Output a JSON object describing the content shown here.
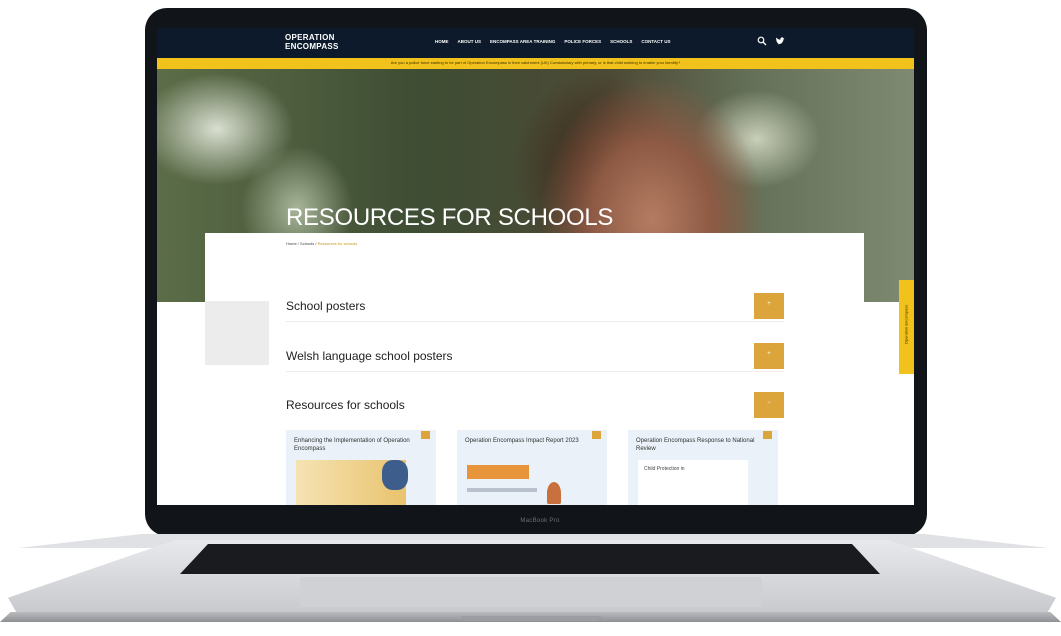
{
  "device": {
    "model_label": "MacBook Pro"
  },
  "site": {
    "logo_line1": "OPERATION",
    "logo_line2": "ENCOMPASS",
    "nav": [
      "HOME",
      "ABOUT US",
      "ENCOMPASS AREA TRAINING",
      "POLICE FORCES",
      "SCHOOLS",
      "CONTACT US"
    ],
    "icons": [
      "search-icon",
      "twitter-icon"
    ],
    "banner_text": "Are you a police force starting to be part of Operation Encompass in their catchment (UK) Constabulary with primary, or is that child working to enable your identity?",
    "hero_title": "RESOURCES FOR SCHOOLS",
    "breadcrumb": {
      "home": "Home",
      "sep": "/",
      "section": "Schools",
      "current": "Resources for schools"
    },
    "accordion": [
      {
        "title": "School posters",
        "button": "+"
      },
      {
        "title": "Welsh language school posters",
        "button": "+"
      },
      {
        "title": "Resources for schools",
        "button": "−"
      }
    ],
    "cards": [
      {
        "title": "Enhancing the Implementation of Operation Encompass"
      },
      {
        "title": "Operation Encompass Impact Report 2023"
      },
      {
        "title": "Operation Encompass Response to National Review",
        "thumb_text": "Child Protection in"
      }
    ],
    "side_tab": "Operation Encompass"
  },
  "colors": {
    "nav_bg": "#0d1a2b",
    "accent_yellow": "#f2c21c",
    "button_gold": "#dba53c",
    "card_bg": "#eaf1f8"
  }
}
